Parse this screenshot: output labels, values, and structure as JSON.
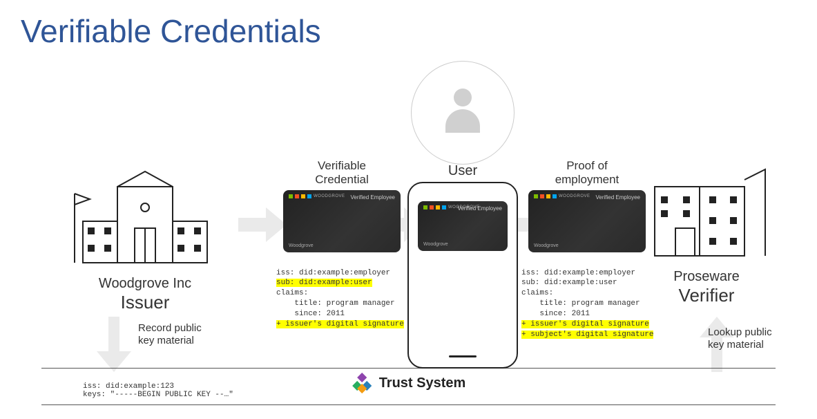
{
  "title": "Verifiable Credentials",
  "issuer": {
    "name": "Woodgrove Inc",
    "role": "Issuer"
  },
  "user": {
    "label": "User"
  },
  "verifier": {
    "name": "Proseware",
    "role": "Verifier"
  },
  "cred1": {
    "label_l1": "Verifiable",
    "label_l2": "Credential",
    "iss": "iss: did:example:employer",
    "sub": "sub: did:example:user",
    "claims_h": "claims:",
    "title": "    title: program manager",
    "since": "    since: 2011",
    "sig1": "+ issuer's digital signature"
  },
  "cred2": {
    "label_l1": "Proof of",
    "label_l2": "employment",
    "iss": "iss: did:example:employer",
    "sub": "sub: did:example:user",
    "claims_h": "claims:",
    "title": "    title: program manager",
    "since": "    since: 2011",
    "sig1": "+ issuer's digital signature",
    "sig2": "+ subject's digital signature"
  },
  "card": {
    "brand": "WOODGROVE",
    "verified": "Verified Employee",
    "company": "Woodgrove"
  },
  "record_label_l1": "Record public",
  "record_label_l2": "key material",
  "lookup_label_l1": "Lookup public",
  "lookup_label_l2": "key material",
  "trust": {
    "label": "Trust System"
  },
  "footer_keys_l1": "iss: did:example:123",
  "footer_keys_l2": "keys: \"-----BEGIN PUBLIC KEY --…\""
}
